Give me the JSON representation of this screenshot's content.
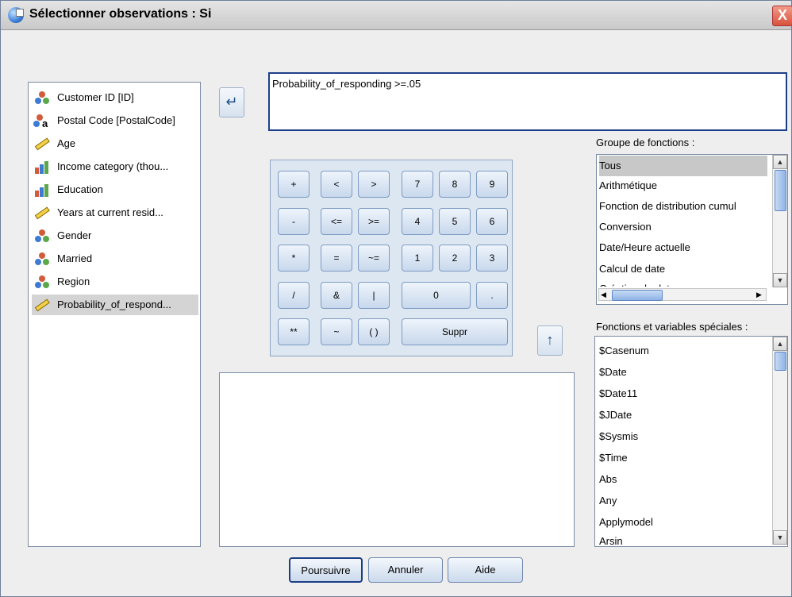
{
  "window": {
    "title": "Sélectionner observations : Si",
    "close_glyph": "X"
  },
  "variables": [
    {
      "label": "Customer ID [ID]",
      "icon": "nominal-icon"
    },
    {
      "label": "Postal Code [PostalCode]",
      "icon": "string-nominal-icon"
    },
    {
      "label": "Age",
      "icon": "scale-icon"
    },
    {
      "label": "Income category (thou...",
      "icon": "ordinal-icon"
    },
    {
      "label": "Education",
      "icon": "ordinal-icon"
    },
    {
      "label": "Years at current resid...",
      "icon": "scale-icon"
    },
    {
      "label": "Gender",
      "icon": "nominal-icon"
    },
    {
      "label": "Married",
      "icon": "nominal-icon"
    },
    {
      "label": "Region",
      "icon": "nominal-icon"
    },
    {
      "label": "Probability_of_respond...",
      "icon": "scale-icon",
      "selected": true
    }
  ],
  "expression": "Probability_of_responding >=.05",
  "keypad": {
    "plus": "+",
    "lt": "<",
    "gt": ">",
    "seven": "7",
    "eight": "8",
    "nine": "9",
    "minus": "-",
    "le": "<=",
    "ge": ">=",
    "four": "4",
    "five": "5",
    "six": "6",
    "times": "*",
    "eq": "=",
    "ne": "~=",
    "one": "1",
    "two": "2",
    "three": "3",
    "divide": "/",
    "and": "&",
    "or": "|",
    "zero": "0",
    "dot": ".",
    "power": "**",
    "not": "~",
    "parens": "( )",
    "delete": "Suppr"
  },
  "function_group": {
    "label": "Groupe de fonctions :",
    "items": [
      "Tous",
      "Arithmétique",
      "Fonction de distribution cumul",
      "Conversion",
      "Date/Heure actuelle",
      "Calcul de date",
      "Création de date"
    ],
    "selected_index": 0
  },
  "functions": {
    "label": "Fonctions et variables spéciales :",
    "items": [
      "$Casenum",
      "$Date",
      "$Date11",
      "$JDate",
      "$Sysmis",
      "$Time",
      "Abs",
      "Any",
      "Applymodel",
      "Arsin"
    ]
  },
  "buttons": {
    "continue": "Poursuivre",
    "cancel": "Annuler",
    "help": "Aide"
  },
  "colors": {
    "accent_border": "#1d3f8a",
    "selection": "#d4d4d4"
  }
}
